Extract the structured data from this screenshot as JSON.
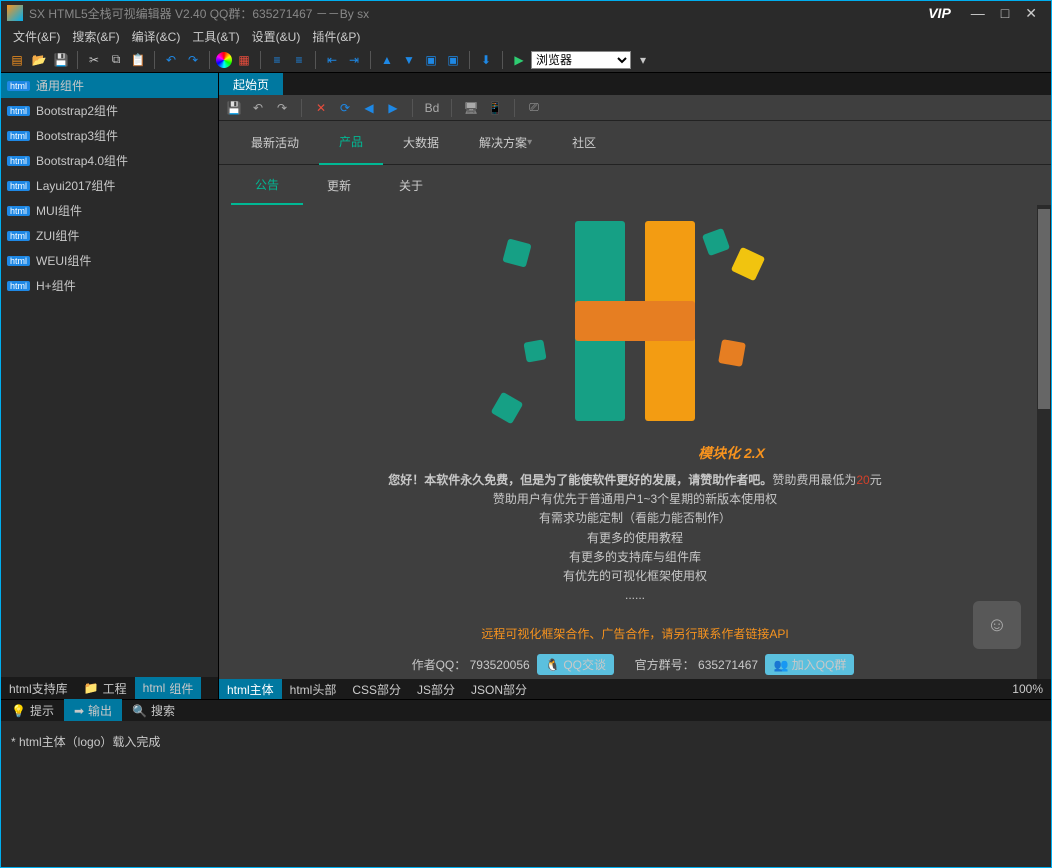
{
  "window": {
    "title": "SX HTML5全栈可视编辑器  V2.40 QQ群：635271467 －－By sx",
    "vip": "VIP"
  },
  "menubar": [
    "文件(&F)",
    "搜索(&F)",
    "编译(&C)",
    "工具(&T)",
    "设置(&U)",
    "插件(&P)"
  ],
  "toolbar": {
    "browser_label": "浏览器"
  },
  "sidebar": {
    "header": "通用组件",
    "items": [
      "Bootstrap2组件",
      "Bootstrap3组件",
      "Bootstrap4.0组件",
      "Layui2017组件",
      "MUI组件",
      "ZUI组件",
      "WEUI组件",
      "H+组件"
    ],
    "tabs": {
      "support": "html支持库",
      "project": "工程",
      "components": "组件"
    },
    "tag": "html"
  },
  "docTabs": {
    "start": "起始页"
  },
  "pageToolbar": {
    "bd": "Bd"
  },
  "pageNav": [
    "最新活动",
    "产品",
    "大数据",
    "解决方案",
    "社区"
  ],
  "pageNavActive": 1,
  "subNav": [
    "公告",
    "更新",
    "关于"
  ],
  "subNavActive": 0,
  "tagline": "模块化 2.X",
  "msg": {
    "line1a": "您好！本软件永久免费，但是为了能使软件更好的发展，请赞助作者吧。",
    "line1b": "赞助费用最低为",
    "line1c": "20",
    "line1d": "元",
    "line2": "赞助用户有优先于普通用户1~3个星期的新版本使用权",
    "line3": "有需求功能定制（看能力能否制作）",
    "line4": "有更多的使用教程",
    "line5": "有更多的支持库与组件库",
    "line6": "有优先的可视化框架使用权",
    "line7": "......",
    "line8": "远程可视化框架合作、广告合作，请另行联系作者链接API",
    "qqLabel": "作者QQ：",
    "qqNum": "793520056",
    "qqBtn": "QQ交谈",
    "groupLabel": "官方群号：",
    "groupNum": "635271467",
    "groupBtn": "加入QQ群"
  },
  "bottomTabs": [
    "html主体",
    "html头部",
    "CSS部分",
    "JS部分",
    "JSON部分"
  ],
  "zoom": "100%",
  "consoleTabs": {
    "tip": "提示",
    "output": "输出",
    "search": "搜索"
  },
  "console": {
    "line": "* html主体（logo）载入完成"
  }
}
